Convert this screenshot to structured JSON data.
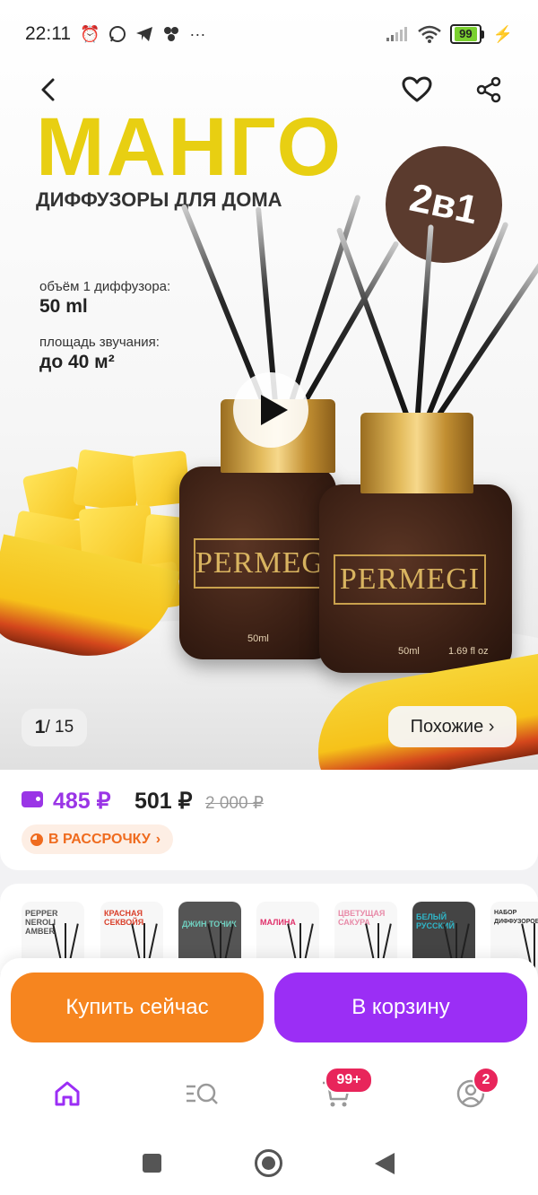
{
  "status_bar": {
    "time": "22:11",
    "notif_icons": [
      "alarm-icon",
      "whatsapp-icon",
      "telegram-icon",
      "apps-icon",
      "more-dots-icon"
    ],
    "more": "···",
    "battery": "99"
  },
  "hero": {
    "title": "МАНГО",
    "subtitle": "ДИФФУЗОРЫ ДЛЯ ДОМА",
    "badge": "2в1",
    "spec1_label": "объём 1 диффузора:",
    "spec1_value": "50 ml",
    "spec2_label": "площадь звучания:",
    "spec2_value": "до 40 м²",
    "bottle_brand": "PERMEGI",
    "bottle1_volume": "50ml",
    "bottle2_volume": "50ml",
    "bottle2_oz": "1.69 fl oz",
    "page_current": "1",
    "page_total": "/ 15",
    "similar_label": "Похожие ›"
  },
  "price": {
    "main": "485 ₽",
    "regular": "501 ₽",
    "old": "2 000 ₽",
    "installment_label": "В РАССРОЧКУ",
    "installment_chevron": "›"
  },
  "thumbnails": [
    {
      "title": "PEPPER NEROLI AMBER",
      "color": "#555555"
    },
    {
      "title": "КРАСНАЯ СЕКВОЙЯ",
      "color": "#d9402b"
    },
    {
      "title": "ДЖИН ТОНИК",
      "color": "#6fd0c0"
    },
    {
      "title": "МАЛИНА",
      "color": "#e0306a"
    },
    {
      "title": "ЦВЕТУЩАЯ САКУРА",
      "color": "#e88aa8"
    },
    {
      "title": "БЕЛЫЙ РУССКИЙ",
      "color": "#2fb6c8"
    },
    {
      "title": "НАБОР ДИФФУЗОРОВ",
      "color": "#333333"
    }
  ],
  "actions": {
    "buy_now": "Купить сейчас",
    "add_to_cart": "В корзину"
  },
  "tabs": {
    "cart_badge": "99+",
    "profile_badge": "2"
  },
  "colors": {
    "accent_purple": "#9b2ef5",
    "accent_orange": "#f6851f",
    "badge_red": "#e8255b",
    "mango_yellow": "#e8cf12"
  }
}
